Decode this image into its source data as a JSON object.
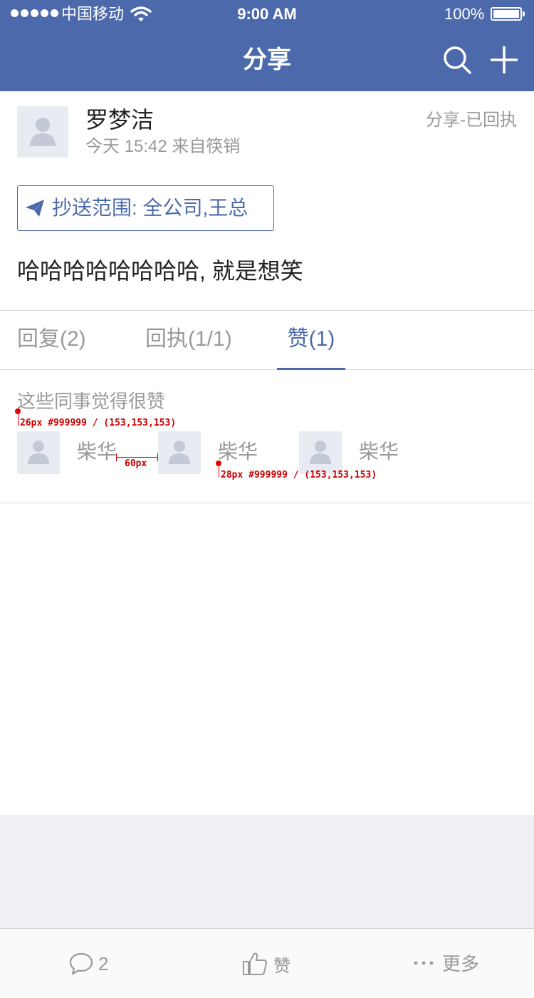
{
  "status_bar": {
    "carrier": "中国移动",
    "time": "9:00 AM",
    "battery": "100%"
  },
  "nav": {
    "title": "分享",
    "icons": [
      "search-icon",
      "plus-icon"
    ]
  },
  "post": {
    "author": "罗梦洁",
    "meta": "今天 15:42 来自筷销",
    "status": "分享-已回执",
    "cc_label": "抄送范围:  全公司,王总",
    "content": "哈哈哈哈哈哈哈哈,  就是想笑"
  },
  "tabs": [
    {
      "label": "回复(2)",
      "active": false
    },
    {
      "label": "回执(1/1)",
      "active": false
    },
    {
      "label": "赞(1)",
      "active": true
    }
  ],
  "likes": {
    "title": "这些同事觉得很赞",
    "users": [
      {
        "name": "柴华"
      },
      {
        "name": "柴华"
      },
      {
        "name": "柴华"
      }
    ]
  },
  "annotations": {
    "title_spec": "26px #999999 / (153,153,153)",
    "spacing_spec": "60px",
    "name_spec": "28px #999999 / (153,153,153)"
  },
  "bottom_bar": {
    "comment_count": "2",
    "like_label": "赞",
    "more_label": "更多"
  },
  "colors": {
    "brand": "#4c6aab",
    "text_primary": "#222222",
    "text_secondary": "#999999",
    "annotation": "#e00000",
    "footer_bg": "#eef0f4"
  }
}
